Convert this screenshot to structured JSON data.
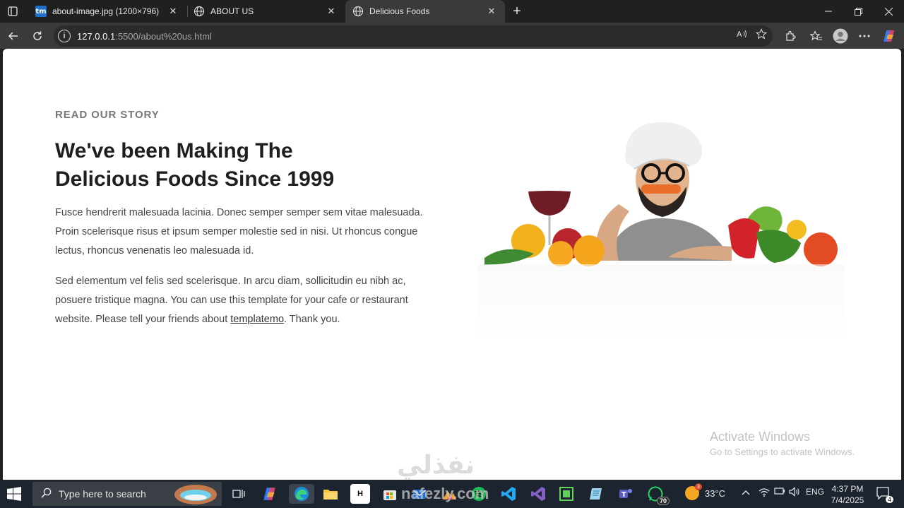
{
  "browser": {
    "tabs": [
      {
        "title": "about-image.jpg (1200×796)",
        "favicon": "tm",
        "active": false
      },
      {
        "title": "ABOUT US",
        "favicon": "globe-icon",
        "active": false
      },
      {
        "title": "Delicious Foods",
        "favicon": "globe-icon",
        "active": true
      }
    ],
    "url_host": "127.0.0.1",
    "url_rest": ":5500/about%20us.html"
  },
  "page": {
    "eyebrow": "READ OUR STORY",
    "headline": "We've been Making The Delicious Foods Since 1999",
    "para1": "Fusce hendrerit malesuada lacinia. Donec semper semper sem vitae malesuada. Proin scelerisque risus et ipsum semper molestie sed in nisi. Ut rhoncus congue lectus, rhoncus venenatis leo malesuada id.",
    "para2_before": "Sed elementum vel felis sed scelerisque. In arcu diam, sollicitudin eu nibh ac, posuere tristique magna. You can use this template for your cafe or restaurant website. Please tell your friends about ",
    "para2_link": "templatemo",
    "para2_after": ". Thank you."
  },
  "activation": {
    "line1": "Activate Windows",
    "line2": "Go to Settings to activate Windows."
  },
  "taskbar": {
    "search_placeholder": "Type here to search",
    "whatsapp_badge": "70",
    "temperature": "33°C",
    "language": "ENG",
    "time": "4:37 PM",
    "date": "7/4/2025",
    "notifications": "4"
  },
  "watermark": {
    "arabic": "نفذلي",
    "latin": "nafezly.com"
  }
}
